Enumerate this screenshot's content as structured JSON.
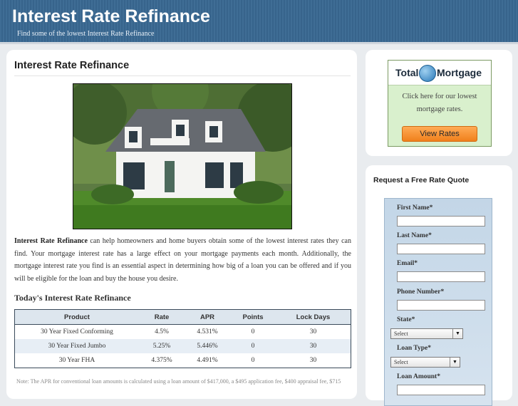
{
  "header": {
    "title": "Interest Rate Refinance",
    "tagline": "Find some of the lowest Interest Rate Refinance"
  },
  "main": {
    "title": "Interest Rate Refinance",
    "photo_alt": "house photo",
    "intro_lead": "Interest Rate Refinance",
    "intro_rest": " can help homeowners and home buyers obtain some of the lowest interest rates they can find. Your mortgage interest rate has a large effect on your mortgage payments each month. Additionally, the mortgage interest rate you find is an essential aspect in determining how big of a loan you can be offered and if you will be eligible for the loan and buy the house you desire.",
    "section_title": "Today's Interest Rate Refinance",
    "table": {
      "headers": [
        "Product",
        "Rate",
        "APR",
        "Points",
        "Lock Days"
      ],
      "rows": [
        [
          "30 Year Fixed Conforming",
          "4.5%",
          "4.531%",
          "0",
          "30"
        ],
        [
          "30 Year Fixed Jumbo",
          "5.25%",
          "5.446%",
          "0",
          "30"
        ],
        [
          "30 Year FHA",
          "4.375%",
          "4.491%",
          "0",
          "30"
        ]
      ]
    },
    "note": "Note: The APR for conventional loan amounts is calculated using a loan amount of $417,000, a $495 application fee, $400 appraisal fee, $715"
  },
  "ad": {
    "logo_left": "Total",
    "logo_right": "Mortgage",
    "text": "Click here for our lowest mortgage rates.",
    "button": "View Rates"
  },
  "quote": {
    "title": "Request a Free Rate Quote",
    "first_name_label": "First Name*",
    "last_name_label": "Last Name*",
    "email_label": "Email*",
    "phone_label": "Phone Number*",
    "state_label": "State*",
    "state_value": "Select",
    "loan_type_label": "Loan Type*",
    "loan_type_value": "Select",
    "loan_amount_label": "Loan Amount*"
  }
}
